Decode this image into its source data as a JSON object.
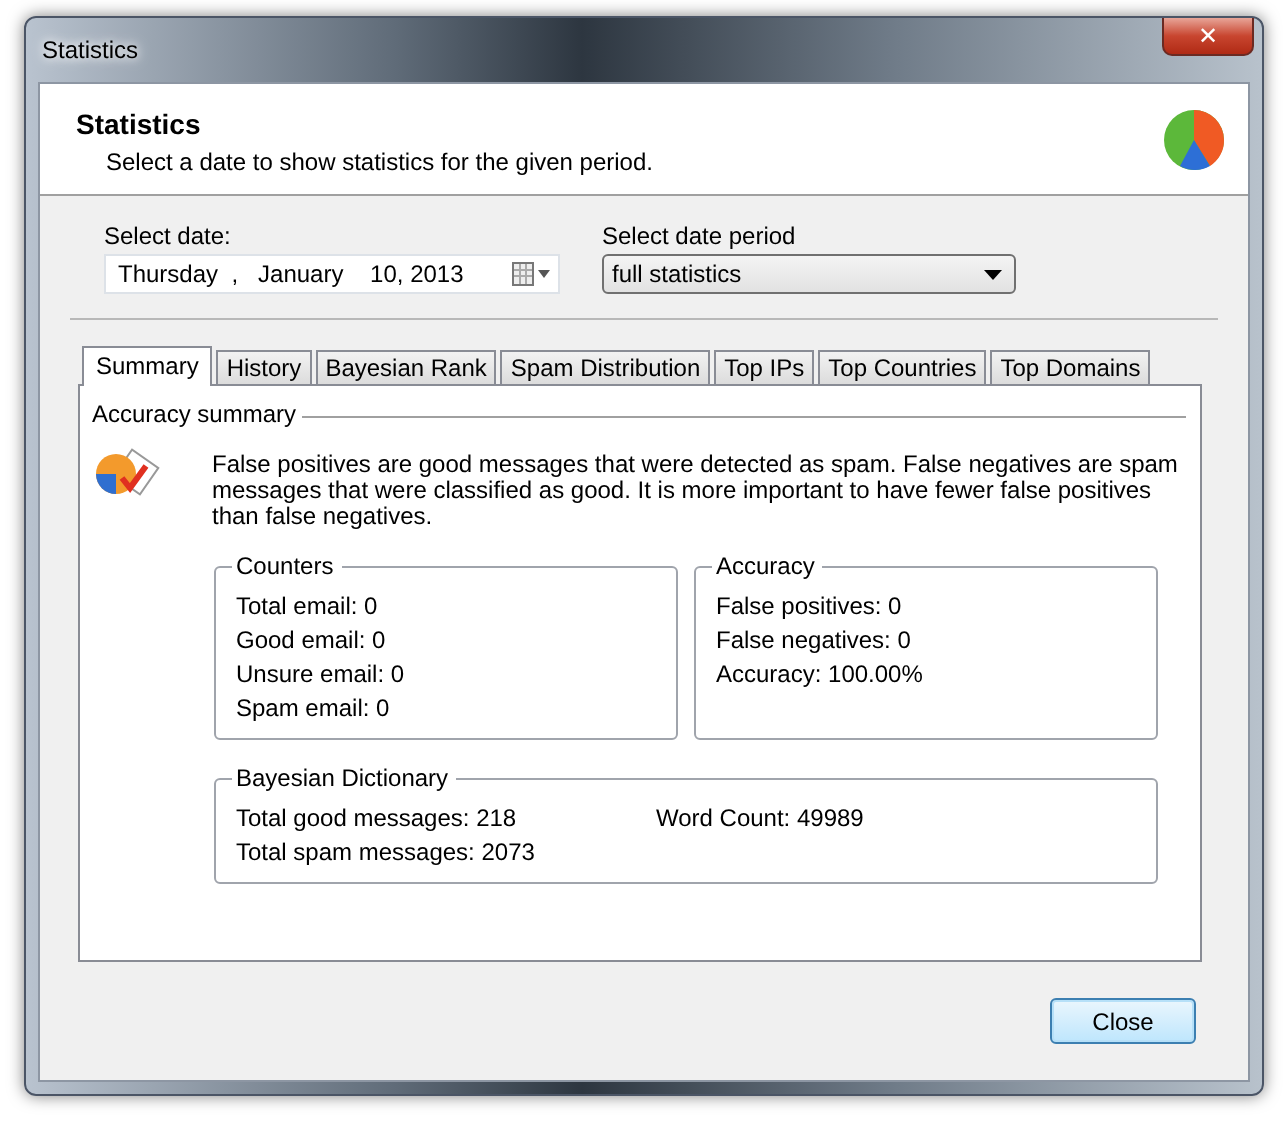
{
  "window": {
    "title": "Statistics",
    "close_glyph": "✕"
  },
  "header": {
    "title": "Statistics",
    "subtitle": "Select a date to show statistics for the given period."
  },
  "date": {
    "label": "Select date:",
    "value": "Thursday  ,   January    10, 2013"
  },
  "period": {
    "label": "Select date period",
    "value": "full statistics"
  },
  "tabs": [
    {
      "label": "Summary",
      "selected": true
    },
    {
      "label": "History",
      "selected": false
    },
    {
      "label": "Bayesian Rank",
      "selected": false
    },
    {
      "label": "Spam Distribution",
      "selected": false
    },
    {
      "label": "Top IPs",
      "selected": false
    },
    {
      "label": "Top Countries",
      "selected": false
    },
    {
      "label": "Top Domains",
      "selected": false
    }
  ],
  "summary": {
    "heading": "Accuracy summary",
    "text": "False positives are good messages that were detected as spam. False negatives are spam messages that were classified as good. It is more important to have fewer false positives than false negatives.",
    "groups": [
      {
        "title": "Counters",
        "columns": [
          [
            "Total email: 0",
            "Good email: 0",
            "Unsure email: 0",
            "Spam email: 0"
          ]
        ]
      },
      {
        "title": "Accuracy",
        "columns": [
          [
            "False positives: 0",
            "False negatives: 0",
            "Accuracy: 100.00%"
          ]
        ]
      },
      {
        "title": "Bayesian Dictionary",
        "columns": [
          [
            "Total good messages: 218",
            "Total spam messages: 2073"
          ],
          [
            "Word Count: 49989"
          ]
        ]
      }
    ]
  },
  "buttons": [
    "Close"
  ]
}
